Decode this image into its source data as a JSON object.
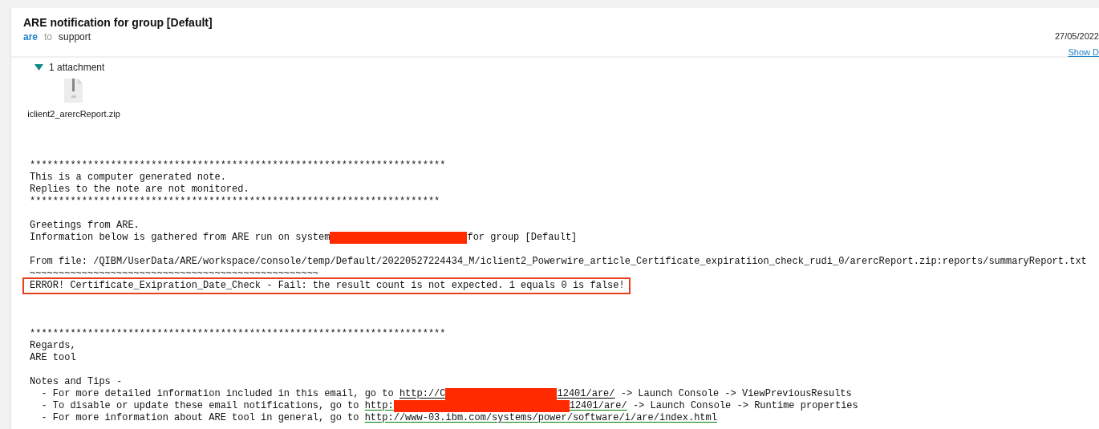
{
  "message": {
    "subject": "ARE notification for group [Default]",
    "sender": "are",
    "to_word": "to",
    "recipient": "support",
    "date": "27/05/2022",
    "details_link": "Show D"
  },
  "attachments": {
    "expanded": true,
    "summary": "1 attachment",
    "files": [
      {
        "name": "iclient2_arercReport.zip"
      }
    ]
  },
  "body_lines": [
    {
      "kind": "text",
      "segments": [
        {
          "kind": "text",
          "text": "************************************************************************"
        }
      ]
    },
    {
      "kind": "text",
      "segments": [
        {
          "kind": "text",
          "text": "This is a computer generated note."
        }
      ]
    },
    {
      "kind": "text",
      "segments": [
        {
          "kind": "text",
          "text": "Replies to the note are not monitored."
        }
      ]
    },
    {
      "kind": "text",
      "segments": [
        {
          "kind": "text",
          "text": "***********************************************************************"
        }
      ]
    },
    {
      "kind": "blank"
    },
    {
      "kind": "text",
      "segments": [
        {
          "kind": "text",
          "text": "Greetings from ARE."
        }
      ]
    },
    {
      "kind": "text",
      "segments": [
        {
          "kind": "text",
          "text": "Information below is gathered from ARE run on system"
        },
        {
          "kind": "redacted"
        },
        {
          "kind": "text",
          "text": "for group [Default]"
        }
      ]
    },
    {
      "kind": "blank"
    },
    {
      "kind": "text",
      "segments": [
        {
          "kind": "text",
          "text": "From file: /QIBM/UserData/ARE/workspace/console/temp/Default/20220527224434_M/iclient2_Powerwire_article_Certificate_expiratiion_check_rudi_0/arercReport.zip:reports/summaryReport.txt"
        }
      ]
    },
    {
      "kind": "text",
      "segments": [
        {
          "kind": "text",
          "text": "~~~~~~~~~~~~~~~~~~~~~~~~~~~~~~~~~~~~~~~~~~~~~~~~~~"
        }
      ]
    },
    {
      "kind": "boxed",
      "segments": [
        {
          "kind": "text",
          "text": "ERROR! Certificate_Exipration_Date_Check - Fail: the result count is not expected. 1 equals 0 is false!"
        }
      ]
    },
    {
      "kind": "blank"
    },
    {
      "kind": "blank"
    },
    {
      "kind": "blank"
    },
    {
      "kind": "text",
      "segments": [
        {
          "kind": "text",
          "text": "************************************************************************"
        }
      ]
    },
    {
      "kind": "text",
      "segments": [
        {
          "kind": "text",
          "text": "Regards,"
        }
      ]
    },
    {
      "kind": "text",
      "segments": [
        {
          "kind": "text",
          "text": "ARE tool"
        }
      ]
    },
    {
      "kind": "blank"
    },
    {
      "kind": "text",
      "segments": [
        {
          "kind": "text",
          "text": "Notes and Tips -"
        }
      ]
    },
    {
      "kind": "text",
      "segments": [
        {
          "kind": "text",
          "text": "  - For more detailed information included in this email, go to "
        },
        {
          "kind": "link",
          "text": "http://C",
          "color": "#000000"
        },
        {
          "kind": "redacted"
        },
        {
          "kind": "link",
          "text": "12401/are/",
          "color": "#000000"
        },
        {
          "kind": "text",
          "text": " -> Launch Console -> ViewPreviousResults"
        }
      ]
    },
    {
      "kind": "text",
      "segments": [
        {
          "kind": "text",
          "text": "  - To disable or update these email notifications, go to "
        },
        {
          "kind": "link",
          "text": "http:",
          "color": "#008000"
        },
        {
          "kind": "redacted"
        },
        {
          "kind": "link",
          "text": "12401/are/",
          "color": "#008000"
        },
        {
          "kind": "text",
          "text": " -> Launch Console -> Runtime properties"
        }
      ]
    },
    {
      "kind": "text",
      "segments": [
        {
          "kind": "text",
          "text": "  - For more information about ARE tool in general, go to "
        },
        {
          "kind": "link",
          "text": "http://www-03.ibm.com/systems/power/software/i/are/index.html",
          "color": "#008000"
        }
      ]
    }
  ]
}
